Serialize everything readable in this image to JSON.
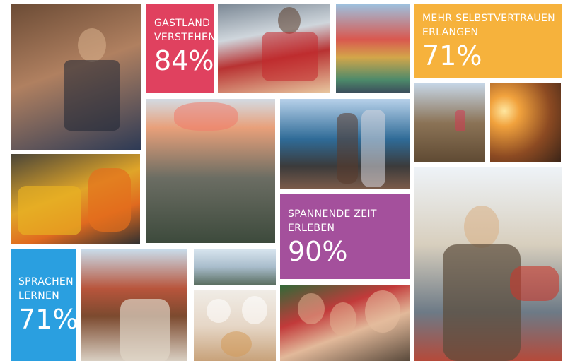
{
  "tiles": {
    "gastland": {
      "label_line1": "GASTLAND",
      "label_line2": "VERSTEHEN",
      "percent": "84%",
      "color": "#e0415f"
    },
    "selbstvertrauen": {
      "label_line1": "MEHR SELBSTVERTRAUEN",
      "label_line2": "ERLANGEN",
      "percent": "71%",
      "color": "#f6b23c"
    },
    "spannende": {
      "label_line1": "SPANNENDE ZEIT",
      "label_line2": "ERLEBEN",
      "percent": "90%",
      "color": "#a4509c"
    },
    "sprachen": {
      "label_line1": "SPRACHEN",
      "label_line2": "LERNEN",
      "percent": "71%",
      "color": "#2a9fe0"
    }
  }
}
